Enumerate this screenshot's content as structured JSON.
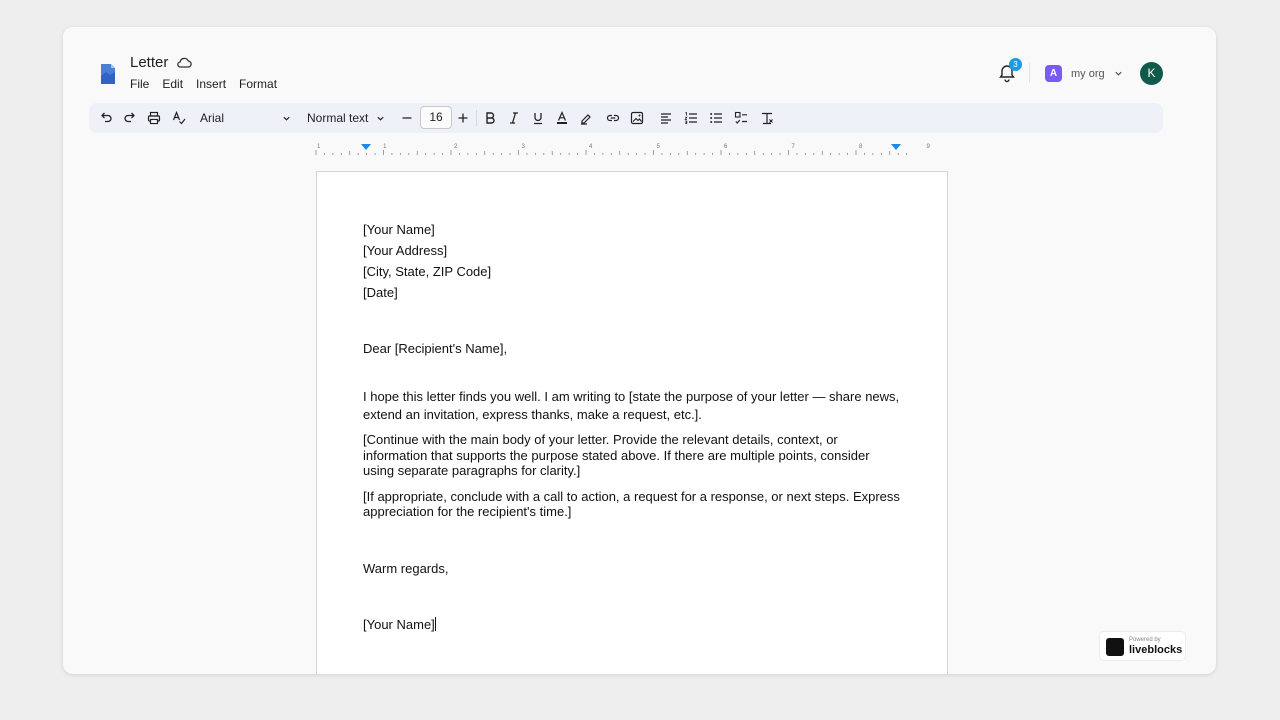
{
  "doc": {
    "title": "Letter"
  },
  "menu": [
    "File",
    "Edit",
    "Insert",
    "Format"
  ],
  "notifications": {
    "count": "3"
  },
  "org": {
    "initial": "A",
    "name": "my org"
  },
  "user": {
    "initial": "K"
  },
  "toolbar": {
    "font_family": "Arial",
    "text_style": "Normal text",
    "font_size": "16"
  },
  "ruler": {
    "labels": [
      "1",
      "1",
      "2",
      "3",
      "4",
      "5",
      "6",
      "7",
      "8",
      "9"
    ]
  },
  "letter": {
    "sender_lines": [
      "[Your Name]",
      "[Your Address]",
      "[City, State, ZIP Code]",
      "[Date]"
    ],
    "salutation": "Dear [Recipient's Name],",
    "paragraphs": [
      "I hope this letter finds you well. I am writing to [state the purpose of your letter — share news, extend an invitation, express thanks, make a request, etc.].",
      "[Continue with the main body of your letter. Provide the relevant details, context, or information that supports the purpose stated above. If there are multiple points, consider using separate paragraphs for clarity.]",
      "[If appropriate, conclude with a call to action, a request for a response, or next steps. Express appreciation for the recipient's time.]"
    ],
    "closing": "Warm regards,",
    "signature": "[Your Name]"
  },
  "powered_by": {
    "label": "Powered by",
    "brand": "liveblocks"
  },
  "colors": {
    "accent": "#1e9be0",
    "org": "#7a5af8",
    "avatar": "#0f5a4b",
    "toolbar_bg": "#eef1f7"
  }
}
